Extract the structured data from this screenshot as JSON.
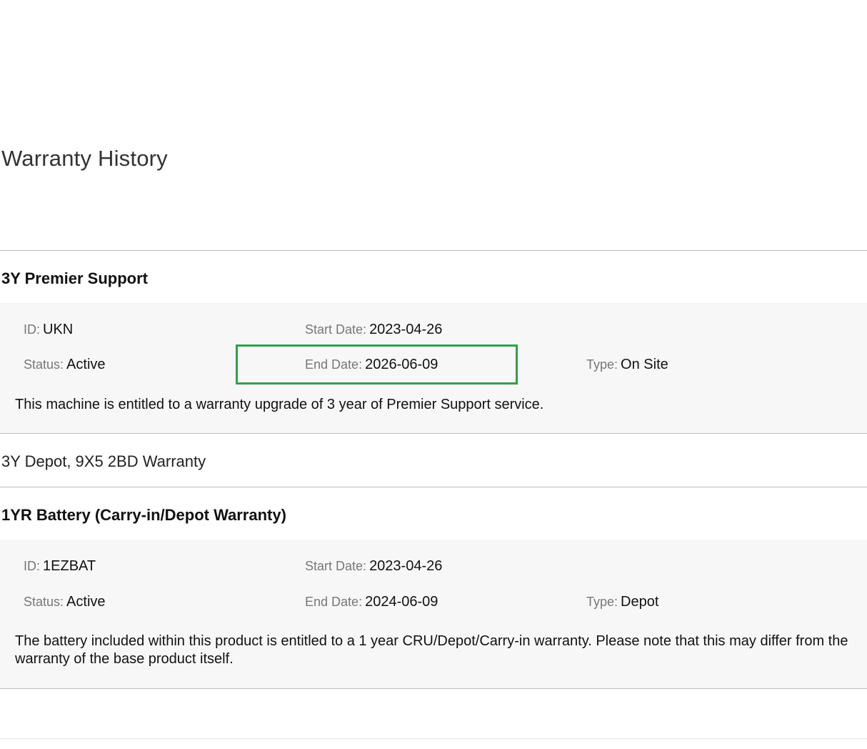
{
  "page": {
    "title": "Warranty History"
  },
  "colors": {
    "highlight": "#2ea24a",
    "panel_background": "#f7f7f7",
    "label_text": "#777777"
  },
  "warranties": [
    {
      "name": "3Y Premier Support",
      "id_label": "ID",
      "id_value": "UKN",
      "start_label": "Start Date",
      "start_value": "2023-04-26",
      "status_label": "Status",
      "status_value": "Active",
      "end_label": "End Date",
      "end_value": "2026-06-09",
      "type_label": "Type",
      "type_value": "On Site",
      "description": "This machine is entitled to a warranty upgrade of 3 year of Premier Support service."
    },
    {
      "name": "3Y Depot, 9X5 2BD Warranty"
    },
    {
      "name": "1YR Battery (Carry-in/Depot Warranty)",
      "id_label": "ID",
      "id_value": "1EZBAT",
      "start_label": "Start Date",
      "start_value": "2023-04-26",
      "status_label": "Status",
      "status_value": "Active",
      "end_label": "End Date",
      "end_value": "2024-06-09",
      "type_label": "Type",
      "type_value": "Depot",
      "description": "The battery included within this product is entitled to a 1 year CRU/Depot/Carry-in warranty. Please note that this may differ from the warranty of the base product itself."
    }
  ]
}
